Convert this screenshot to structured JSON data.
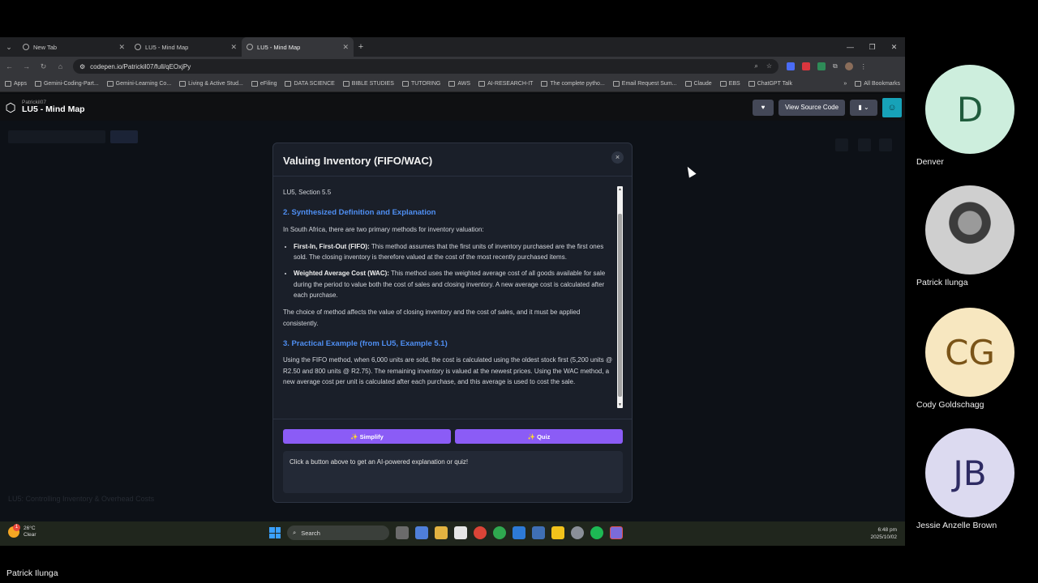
{
  "browser": {
    "tabs": [
      {
        "label": "New Tab",
        "active": false
      },
      {
        "label": "LU5 - Mind Map",
        "active": false
      },
      {
        "label": "LU5 - Mind Map",
        "active": true
      }
    ],
    "url": "codepen.io/Patrickil07/full/qEOxjPy",
    "bookmarks": [
      "Apps",
      "Gemini-Coding-Part...",
      "Gemini-Learning Co...",
      "Living & Active Stud...",
      "eFiling",
      "DATA SCIENCE",
      "BIBLE STUDIES",
      "TUTORING",
      "AWS",
      "AI-RESEARCH-IT",
      "The complete pytho...",
      "Email Request Sum...",
      "Claude",
      "EBS",
      "ChatGPT Talk"
    ],
    "all_bookmarks": "All Bookmarks",
    "overflow": "»"
  },
  "codepen": {
    "user": "Patrickil07",
    "title": "LU5 - Mind Map",
    "view_source_label": "View Source Code"
  },
  "background": {
    "footer_title": "LU5: Controlling Inventory & Overhead Costs"
  },
  "modal": {
    "title": "Valuing Inventory (FIFO/WAC)",
    "section_ref": "LU5, Section 5.5",
    "heading_2": "2. Synthesized Definition and Explanation",
    "intro": "In South Africa, there are two primary methods for inventory valuation:",
    "methods": [
      {
        "term": "First-In, First-Out (FIFO):",
        "text": " This method assumes that the first units of inventory purchased are the first ones sold. The closing inventory is therefore valued at the cost of the most recently purchased items."
      },
      {
        "term": "Weighted Average Cost (WAC):",
        "text": " This method uses the weighted average cost of all goods available for sale during the period to value both the cost of sales and closing inventory. A new average cost is calculated after each purchase."
      }
    ],
    "choice_text": "The choice of method affects the value of closing inventory and the cost of sales, and it must be applied consistently.",
    "heading_3": "3. Practical Example (from LU5, Example 5.1)",
    "example_text": "Using the FIFO method, when 6,000 units are sold, the cost is calculated using the oldest stock first (5,200 units @ R2.50 and 800 units @ R2.75). The remaining inventory is valued at the newest prices. Using the WAC method, a new average cost per unit is calculated after each purchase, and this average is used to cost the sale.",
    "simplify_label": "✨ Simplify",
    "quiz_label": "✨ Quiz",
    "output_text": "Click a button above to get an AI-powered explanation or quiz!",
    "close_glyph": "×"
  },
  "taskbar": {
    "temperature": "26°C",
    "condition": "Clear",
    "weather_badge": "1",
    "search_placeholder": "Search",
    "time": "6:48 pm",
    "date": "2025/10/02"
  },
  "participants": [
    {
      "initials": "D",
      "name": "Denver",
      "bg": "#cdeedd",
      "fg": "#1f5c3c"
    },
    {
      "initials": "",
      "name": "Patrick Ilunga",
      "bg": "#cccccc",
      "fg": "#333333"
    },
    {
      "initials": "CG",
      "name": "Cody Goldschagg",
      "bg": "#f7e7c0",
      "fg": "#7a5418"
    },
    {
      "initials": "JB",
      "name": "Jessie Anzelle Brown",
      "bg": "#dcdaf0",
      "fg": "#2e2b63"
    }
  ],
  "presenter": "Patrick Ilunga",
  "colors": {
    "accent_button": "#8b5cf6",
    "heading_blue": "#4f8ff3",
    "modal_bg": "#1a1f29"
  }
}
